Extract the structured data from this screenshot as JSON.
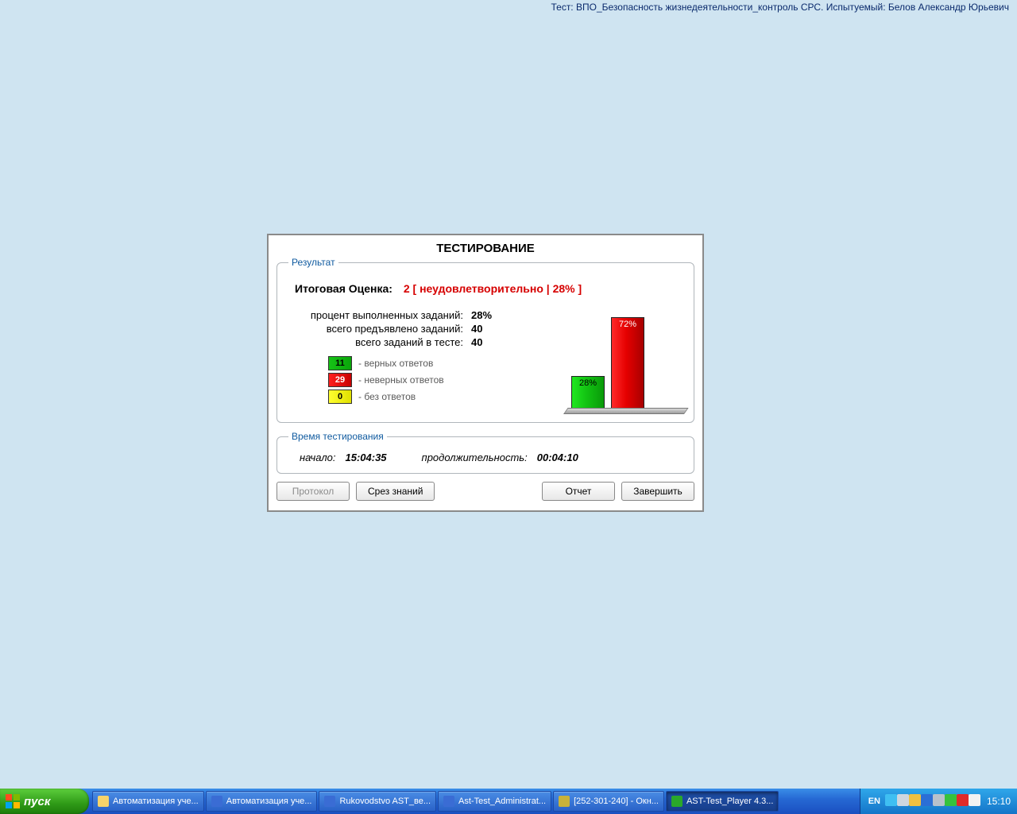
{
  "header": "Тест: ВПО_Безопасность жизнедеятельности_контроль СРС. Испытуемый: Белов Александр Юрьевич",
  "dialog": {
    "title": "ТЕСТИРОВАНИЕ",
    "result_legend": "Результат",
    "grade_label": "Итоговая Оценка:",
    "grade_value": "2   [ неудовлетворительно | 28% ]",
    "stats": {
      "pct_label": "процент выполненных заданий:",
      "pct_value": "28%",
      "given_label": "всего предъявлено заданий:",
      "given_value": "40",
      "total_label": "всего заданий в тесте:",
      "total_value": "40"
    },
    "legend": {
      "correct_n": "11",
      "correct_label": "- верных ответов",
      "wrong_n": "29",
      "wrong_label": "- неверных ответов",
      "blank_n": "0",
      "blank_label": "- без ответов"
    },
    "time_legend": "Время тестирования",
    "time": {
      "start_label": "начало:",
      "start_value": "15:04:35",
      "dur_label": "продолжительность:",
      "dur_value": "00:04:10"
    },
    "buttons": {
      "protocol": "Протокол",
      "slice": "Срез знаний",
      "report": "Отчет",
      "finish": "Завершить"
    }
  },
  "chart_data": {
    "type": "bar",
    "categories": [
      "верных",
      "неверных",
      "без ответов"
    ],
    "values": [
      28,
      72,
      0
    ],
    "labels": [
      "28%",
      "72%",
      ""
    ],
    "colors": [
      "#12c312",
      "#e60000",
      "#e0e000"
    ],
    "ylim": [
      0,
      100
    ],
    "title": "",
    "xlabel": "",
    "ylabel": ""
  },
  "taskbar": {
    "start": "пуск",
    "items": [
      {
        "label": "Автоматизация уче...",
        "icon": "folder-icon",
        "icon_bg": "#f7d36a"
      },
      {
        "label": "Автоматизация уче...",
        "icon": "word-icon",
        "icon_bg": "#3a6cd4"
      },
      {
        "label": "Rukovodstvo AST_ве...",
        "icon": "word-icon",
        "icon_bg": "#3a6cd4"
      },
      {
        "label": "Ast-Test_Administrat...",
        "icon": "word-icon",
        "icon_bg": "#3a6cd4"
      },
      {
        "label": "[252-301-240] - Окн...",
        "icon": "window-icon",
        "icon_bg": "#c8b23a"
      },
      {
        "label": "AST-Test_Player  4.3...",
        "icon": "app-icon",
        "icon_bg": "#2aa82a",
        "active": true
      }
    ],
    "tray": {
      "lang": "EN",
      "icons": [
        {
          "name": "network-icon",
          "bg": "#3fbff2"
        },
        {
          "name": "volume-icon",
          "bg": "#cfd6df"
        },
        {
          "name": "device-icon",
          "bg": "#f0c040"
        },
        {
          "name": "display-icon",
          "bg": "#2b6fd6"
        },
        {
          "name": "printer-icon",
          "bg": "#b9c1cb"
        },
        {
          "name": "shield-icon",
          "bg": "#36c23d"
        },
        {
          "name": "antivirus-icon",
          "bg": "#e12a2a"
        },
        {
          "name": "mail-icon",
          "bg": "#f2f2f2"
        }
      ],
      "clock": "15:10"
    }
  }
}
